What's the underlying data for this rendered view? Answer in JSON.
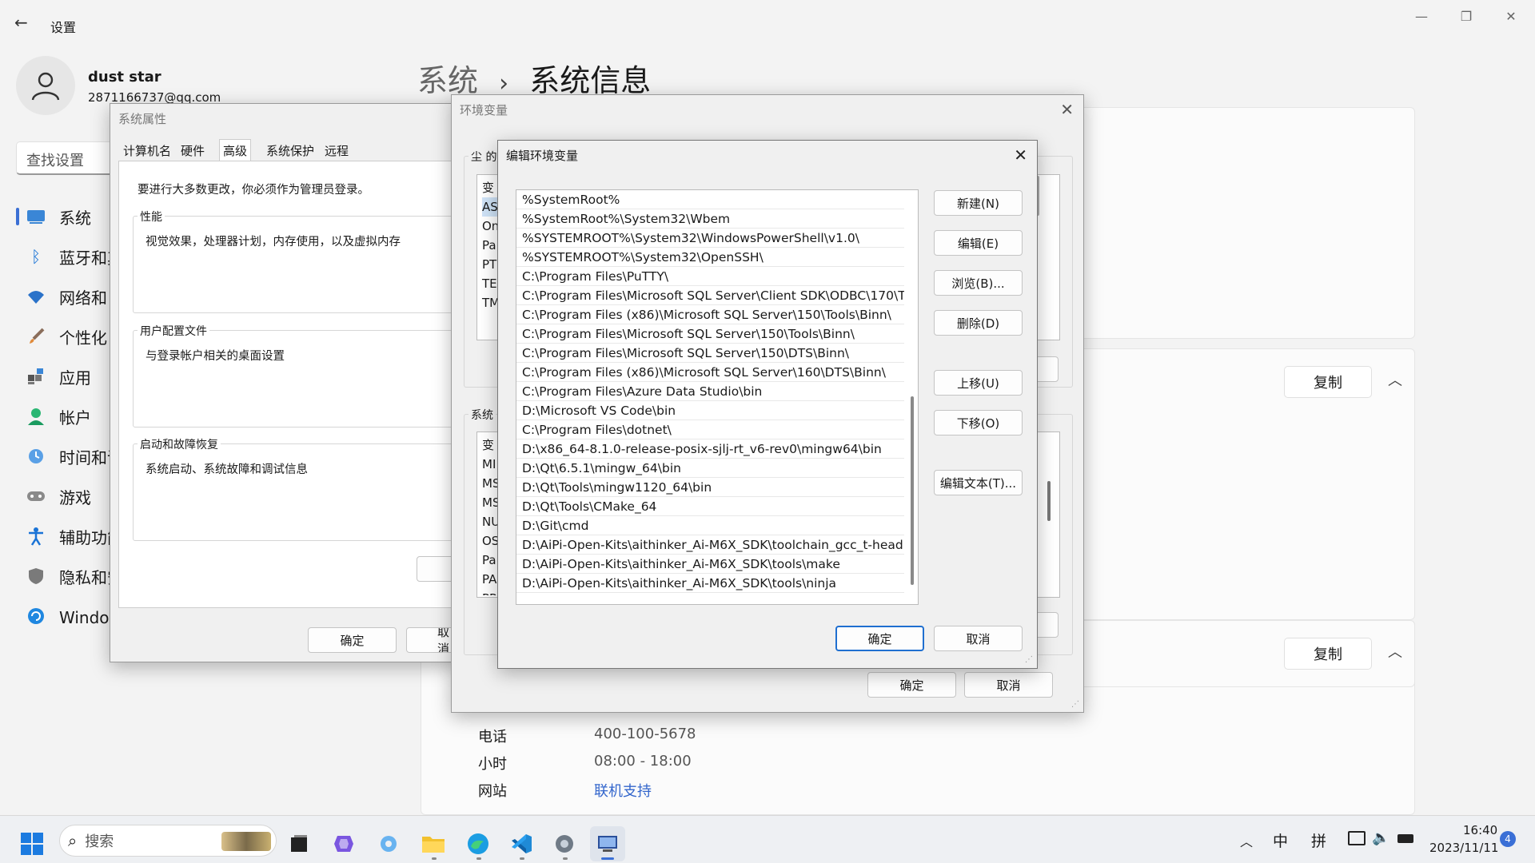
{
  "settings": {
    "back_glyph": "←",
    "title": "设置",
    "user_name": "dust star",
    "user_email": "2871166737@qq.com",
    "search_placeholder": "查找设置",
    "breadcrumb_parent": "系统",
    "breadcrumb_sep": "›",
    "breadcrumb_current": "系统信息",
    "nav": [
      {
        "label": "系统",
        "icon": "system-icon"
      },
      {
        "label": "蓝牙和其他设备",
        "icon": "bluetooth-icon"
      },
      {
        "label": "网络和 Internet",
        "icon": "wifi-icon"
      },
      {
        "label": "个性化",
        "icon": "brush-icon"
      },
      {
        "label": "应用",
        "icon": "apps-icon"
      },
      {
        "label": "帐户",
        "icon": "account-icon"
      },
      {
        "label": "时间和语言",
        "icon": "clock-icon"
      },
      {
        "label": "游戏",
        "icon": "gamepad-icon"
      },
      {
        "label": "辅助功能",
        "icon": "accessibility-icon"
      },
      {
        "label": "隐私和安全性",
        "icon": "shield-icon"
      },
      {
        "label": "Windows 更新",
        "icon": "update-icon"
      }
    ],
    "copy_label": "复制",
    "support": [
      {
        "label": "电话",
        "value": "400-100-5678"
      },
      {
        "label": "小时",
        "value": "08:00 - 18:00"
      },
      {
        "label": "网站",
        "value": "联机支持"
      }
    ]
  },
  "sysprops": {
    "title": "系统属性",
    "tabs": [
      "计算机名",
      "硬件",
      "高级",
      "系统保护",
      "远程"
    ],
    "admin_note": "要进行大多数更改，你必须作为管理员登录。",
    "groups": [
      {
        "title": "性能",
        "desc": "视觉效果，处理器计划，内存使用，以及虚拟内存"
      },
      {
        "title": "用户配置文件",
        "desc": "与登录帐户相关的桌面设置"
      },
      {
        "title": "启动和故障恢复",
        "desc": "系统启动、系统故障和调试信息"
      }
    ],
    "ok": "确定",
    "cancel": "取消"
  },
  "envvars": {
    "title": "环境变量",
    "user_section_prefix": "尘 的",
    "user_vars_partial": [
      "变",
      "AS",
      "On",
      "Pa",
      "PT",
      "TE",
      "TM"
    ],
    "system_section_prefix": "系统",
    "system_vars_partial": [
      "变",
      "MI",
      "MS",
      "MS",
      "NU",
      "OS",
      "Pa",
      "PA",
      "PR"
    ],
    "ok": "确定",
    "cancel": "取消"
  },
  "edit": {
    "title": "编辑环境变量",
    "paths": [
      "%SystemRoot%",
      "%SystemRoot%\\System32\\Wbem",
      "%SYSTEMROOT%\\System32\\WindowsPowerShell\\v1.0\\",
      "%SYSTEMROOT%\\System32\\OpenSSH\\",
      "C:\\Program Files\\PuTTY\\",
      "C:\\Program Files\\Microsoft SQL Server\\Client SDK\\ODBC\\170\\T...",
      "C:\\Program Files (x86)\\Microsoft SQL Server\\150\\Tools\\Binn\\",
      "C:\\Program Files\\Microsoft SQL Server\\150\\Tools\\Binn\\",
      "C:\\Program Files\\Microsoft SQL Server\\150\\DTS\\Binn\\",
      "C:\\Program Files (x86)\\Microsoft SQL Server\\160\\DTS\\Binn\\",
      "C:\\Program Files\\Azure Data Studio\\bin",
      "D:\\Microsoft VS Code\\bin",
      "C:\\Program Files\\dotnet\\",
      "D:\\x86_64-8.1.0-release-posix-sjlj-rt_v6-rev0\\mingw64\\bin",
      "D:\\Qt\\6.5.1\\mingw_64\\bin",
      "D:\\Qt\\Tools\\mingw1120_64\\bin",
      "D:\\Qt\\Tools\\CMake_64",
      "D:\\Git\\cmd",
      "D:\\AiPi-Open-Kits\\aithinker_Ai-M6X_SDK\\toolchain_gcc_t-head...",
      "D:\\AiPi-Open-Kits\\aithinker_Ai-M6X_SDK\\tools\\make",
      "D:\\AiPi-Open-Kits\\aithinker_Ai-M6X_SDK\\tools\\ninja"
    ],
    "buttons": [
      "新建(N)",
      "编辑(E)",
      "浏览(B)...",
      "删除(D)",
      "上移(U)",
      "下移(O)",
      "编辑文本(T)..."
    ],
    "ok": "确定",
    "cancel": "取消"
  },
  "taskbar": {
    "search_placeholder": "搜索",
    "ime_lang": "中",
    "ime_mode": "拼",
    "time": "16:40",
    "date": "2023/11/11",
    "notification_count": "4"
  }
}
